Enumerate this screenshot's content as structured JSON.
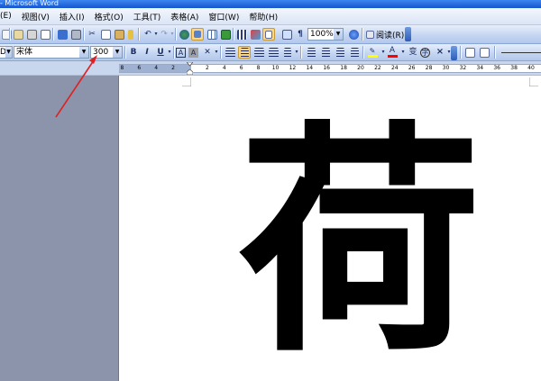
{
  "window": {
    "title": "- Microsoft Word"
  },
  "menu": [
    {
      "label": "(E)",
      "name": "menu-edit"
    },
    {
      "label": "视图(V)",
      "name": "menu-view"
    },
    {
      "label": "插入(I)",
      "name": "menu-insert"
    },
    {
      "label": "格式(O)",
      "name": "menu-format"
    },
    {
      "label": "工具(T)",
      "name": "menu-tools"
    },
    {
      "label": "表格(A)",
      "name": "menu-table"
    },
    {
      "label": "窗口(W)",
      "name": "menu-window"
    },
    {
      "label": "帮助(H)",
      "name": "menu-help"
    }
  ],
  "standard_toolbar": {
    "zoom": "100%",
    "reading_label": "阅读(R)",
    "pilcrow": "¶"
  },
  "format_toolbar": {
    "style_value": "D",
    "font_name": "宋体",
    "font_size": "300",
    "bold": "B",
    "italic": "I",
    "underline": "U",
    "char_border": "A",
    "char_shading": "A",
    "text_color_label": "A",
    "phonetic": "变",
    "enclose": "字",
    "close": "×"
  },
  "ruler": {
    "labels_left": [
      "8",
      "6",
      "4",
      "2"
    ],
    "labels_right": [
      "2",
      "4",
      "6",
      "8",
      "10",
      "12",
      "14",
      "16",
      "18",
      "20",
      "22",
      "24",
      "26",
      "28",
      "30",
      "32",
      "34",
      "36",
      "38",
      "40"
    ]
  },
  "document": {
    "text": "荷"
  },
  "colors": {
    "titlebar": "#1a5fd6",
    "toolbar": "#c3d4f1",
    "workspace": "#8b94aa",
    "arrow": "#e02020",
    "font_color_bar": "#ff0000",
    "highlight_bar": "#ffff00"
  }
}
